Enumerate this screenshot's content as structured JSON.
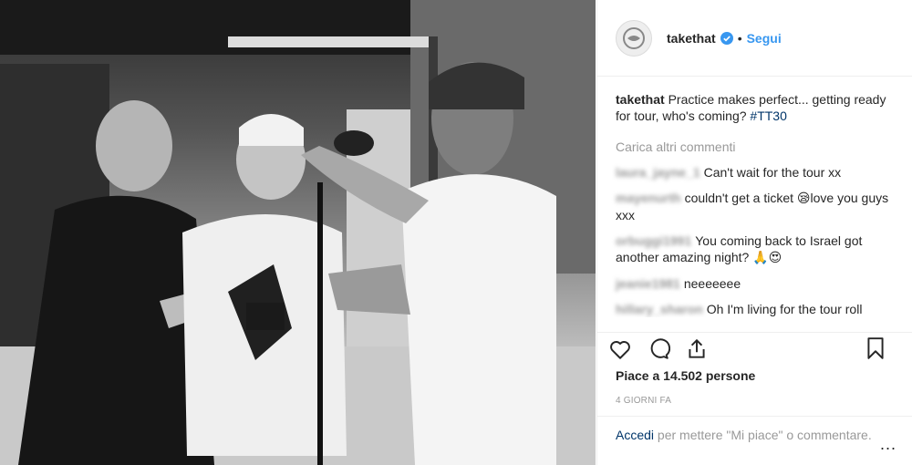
{
  "post": {
    "username": "takethat",
    "separator": "•",
    "follow_label": "Segui"
  },
  "caption": {
    "username": "takethat",
    "text": "Practice makes perfect... getting ready for tour, who's coming?",
    "hashtag": "#TT30"
  },
  "load_more_label": "Carica altri commenti",
  "comments": [
    {
      "user": "laura_jayne_1",
      "text": "Can't wait for the tour xx"
    },
    {
      "user": "mayenurth",
      "text": "couldn't get a ticket",
      "emoji": "😪",
      "text_after": "love you guys xxx"
    },
    {
      "user": "orbuggi1991",
      "text": "You coming back to Israel got another amazing night?",
      "emoji": "🙏😍"
    },
    {
      "user": "jeanie1981",
      "text": "neeeeeee"
    },
    {
      "user": "hillary_sharon",
      "text": "Oh I'm living for the tour roll"
    }
  ],
  "likes_text": "Piace a 14.502 persone",
  "time_text": "4 GIORNI FA",
  "login": {
    "link": "Accedi",
    "rest": "per mettere \"Mi piace\" o commentare.",
    "more": "..."
  },
  "icons": {
    "like": "heart-icon",
    "comment": "comment-icon",
    "share": "share-icon",
    "save": "bookmark-icon",
    "verified": "verified-badge-icon"
  },
  "colors": {
    "accent": "#3897f0",
    "hashtag": "#003569",
    "muted": "#999999",
    "text": "#262626"
  }
}
